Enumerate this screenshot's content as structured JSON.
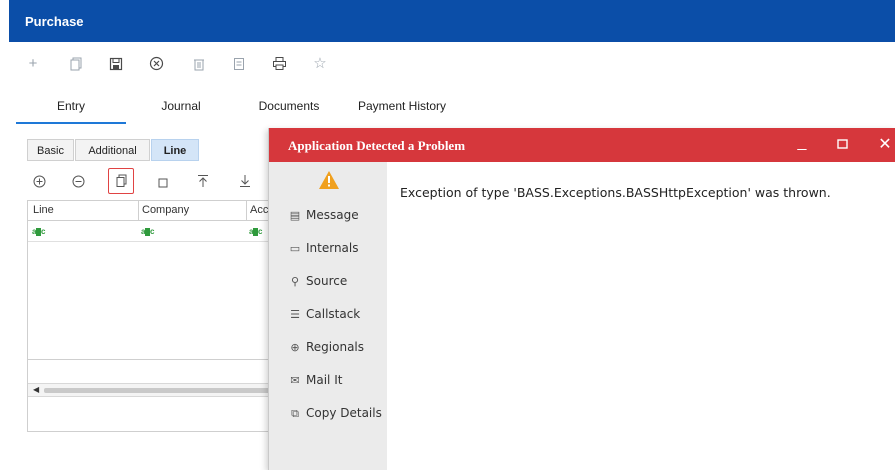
{
  "window": {
    "title": "Purchase"
  },
  "toolbar": {
    "icons": [
      "add-icon",
      "copy-icon",
      "save-icon",
      "cancel-icon",
      "delete-icon",
      "document-icon",
      "print-icon",
      "favorite-icon"
    ]
  },
  "main_tabs": [
    {
      "label": "Entry",
      "active": true
    },
    {
      "label": "Journal",
      "active": false
    },
    {
      "label": "Documents",
      "active": false
    },
    {
      "label": "Payment History",
      "active": false
    }
  ],
  "sub_tabs": [
    {
      "label": "Basic",
      "active": false
    },
    {
      "label": "Additional",
      "active": false
    },
    {
      "label": "Line",
      "active": true
    }
  ],
  "grid_toolbar": {
    "icons": [
      "add-row-icon",
      "remove-row-icon",
      "copy-row-icon",
      "blank-row-icon",
      "move-top-icon",
      "move-bottom-icon"
    ]
  },
  "grid": {
    "columns": [
      "Line",
      "Company",
      "Acc"
    ],
    "row_type_badge": "abc"
  },
  "dialog": {
    "title": "Application Detected a Problem",
    "message": "Exception of type 'BASS.Exceptions.BASSHttpException' was thrown.",
    "sidebar": [
      {
        "label": "Message",
        "icon": "message-icon"
      },
      {
        "label": "Internals",
        "icon": "internals-icon"
      },
      {
        "label": "Source",
        "icon": "pin-icon"
      },
      {
        "label": "Callstack",
        "icon": "callstack-icon"
      },
      {
        "label": "Regionals",
        "icon": "globe-icon"
      },
      {
        "label": "Mail It",
        "icon": "mail-icon"
      },
      {
        "label": "Copy Details",
        "icon": "copy-icon"
      }
    ]
  },
  "colors": {
    "titlebar": "#0b4ea8",
    "dialog_titlebar": "#d6373c",
    "active_tab_underline": "#1e78d7",
    "warning": "#f0a01e"
  }
}
